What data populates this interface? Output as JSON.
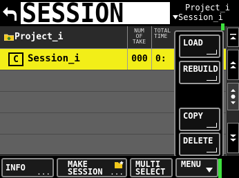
{
  "header": {
    "title": "SESSION",
    "path_line1": "Project_i",
    "path_line2": "Session_i"
  },
  "table": {
    "col_name": "Project_i",
    "col_num": [
      "NUM",
      "OF",
      "TAKE"
    ],
    "col_time": [
      "TOTAL",
      "TIME"
    ],
    "rows": [
      {
        "type_label": "C",
        "name": "Session_i",
        "num_take": "000",
        "total_time": "0:",
        "selected": true
      }
    ]
  },
  "popup_menu": {
    "items": [
      {
        "label": "LOAD"
      },
      {
        "label": "REBUILD"
      },
      {
        "label": "COPY"
      },
      {
        "label": "DELETE"
      }
    ]
  },
  "footer": {
    "info_label": "INFO",
    "info_dots": "...",
    "make_line1": "MAKE",
    "make_line2": "SESSION",
    "make_dots": "...",
    "multi_line1": "MULTI",
    "multi_line2": "SELECT",
    "menu_label": "MENU"
  },
  "colors": {
    "selected_row": "#f2ee18",
    "indicator": "#3de03d",
    "list_bg": "#606060"
  },
  "icons": {
    "back": "back-arrow-icon",
    "parent_folder": "folder-up-icon",
    "make_session": "new-folder-icon",
    "scroll_up": "double-chevron-up-icon",
    "scroll_down": "double-chevron-down-icon"
  }
}
